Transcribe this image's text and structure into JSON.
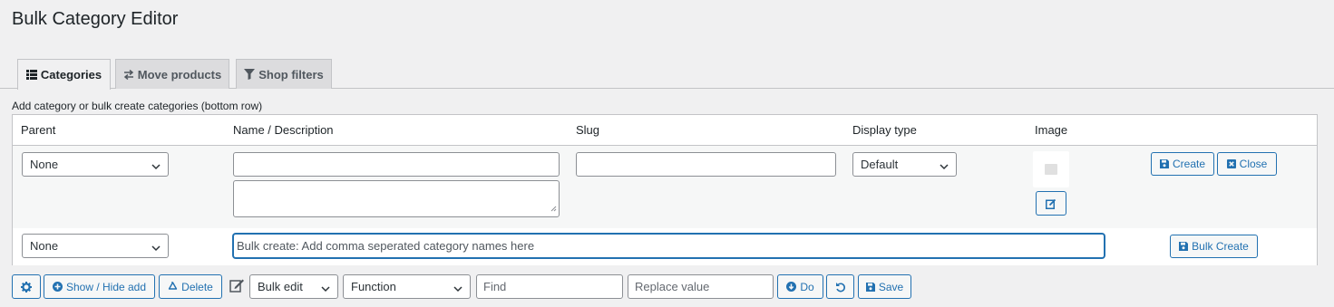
{
  "page": {
    "title": "Bulk Category Editor"
  },
  "tabs": [
    {
      "label": "Categories",
      "icon": "list-icon",
      "active": true
    },
    {
      "label": "Move products",
      "icon": "swap-arrows-icon",
      "active": false
    },
    {
      "label": "Shop filters",
      "icon": "filter-icon",
      "active": false
    }
  ],
  "subtitle": "Add category or bulk create categories (bottom row)",
  "table": {
    "headers": {
      "parent": "Parent",
      "name": "Name / Description",
      "slug": "Slug",
      "display_type": "Display type",
      "image": "Image"
    },
    "add_row": {
      "parent_value": "None",
      "name_value": "",
      "description_value": "",
      "slug_value": "",
      "display_type_value": "Default",
      "create_label": "Create",
      "close_label": "Close"
    },
    "bulk_row": {
      "parent_value": "None",
      "bulk_placeholder": "Bulk create: Add comma seperated category names here",
      "bulk_create_label": "Bulk Create"
    }
  },
  "toolbar": {
    "show_hide_label": "Show / Hide add",
    "delete_label": "Delete",
    "bulk_edit_value": "Bulk edit",
    "function_value": "Function",
    "find_placeholder": "Find",
    "replace_placeholder": "Replace value",
    "do_label": "Do",
    "save_label": "Save"
  },
  "colors": {
    "accent": "#2271b1",
    "background": "#f0f0f1",
    "border": "#c3c4c7",
    "tab_inactive": "#dcdcde"
  }
}
